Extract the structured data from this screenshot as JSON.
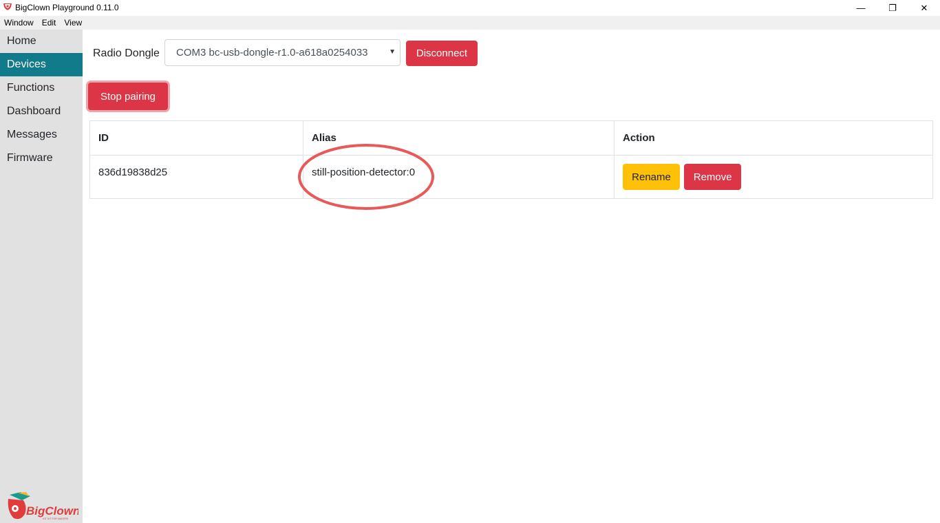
{
  "window": {
    "title": "BigClown Playground 0.11.0",
    "minimize_glyph": "—",
    "maximize_glyph": "❐",
    "close_glyph": "✕"
  },
  "menu": [
    "Window",
    "Edit",
    "View"
  ],
  "sidebar": {
    "items": [
      {
        "label": "Home",
        "active": false
      },
      {
        "label": "Devices",
        "active": true
      },
      {
        "label": "Functions",
        "active": false
      },
      {
        "label": "Dashboard",
        "active": false
      },
      {
        "label": "Messages",
        "active": false
      },
      {
        "label": "Firmware",
        "active": false
      }
    ],
    "logo_text": "BigClown",
    "logo_tagline": "IOT KIT FOR MAKERS"
  },
  "toolbar": {
    "dongle_label": "Radio Dongle",
    "dongle_selected": "COM3 bc-usb-dongle-r1.0-a618a0254033",
    "disconnect_label": "Disconnect",
    "stop_pairing_label": "Stop pairing"
  },
  "table": {
    "headers": {
      "id": "ID",
      "alias": "Alias",
      "action": "Action"
    },
    "rows": [
      {
        "id": "836d19838d25",
        "alias": "still-position-detector:0",
        "rename_label": "Rename",
        "remove_label": "Remove"
      }
    ]
  },
  "colors": {
    "accent": "#117a8b",
    "danger": "#dc3545",
    "warning": "#ffc107",
    "annotation": "#e85a5a"
  }
}
